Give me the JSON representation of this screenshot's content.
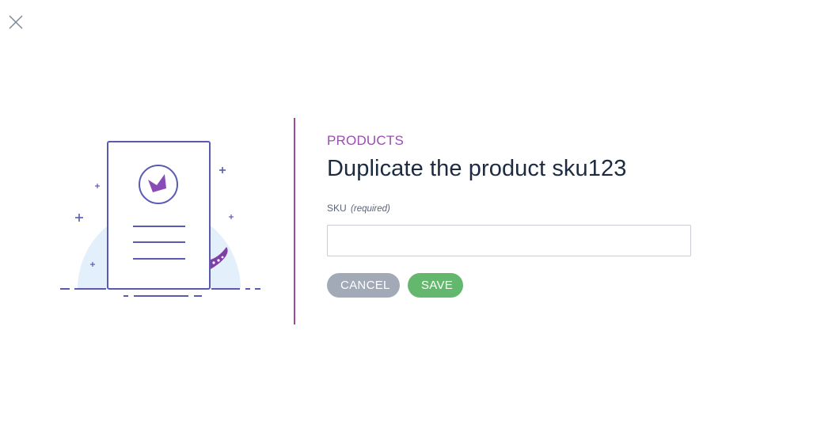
{
  "dialog": {
    "eyebrow": "PRODUCTS",
    "title": "Duplicate the product sku123"
  },
  "form": {
    "sku_label": "SKU",
    "sku_hint": "(required)",
    "sku_value": "",
    "sku_placeholder": ""
  },
  "actions": {
    "cancel_label": "CANCEL",
    "save_label": "SAVE"
  },
  "icons": {
    "close": "close-icon",
    "illustration": "document-illustration"
  },
  "colors": {
    "accent": "#9b4db0",
    "title": "#1d2b42",
    "cancel": "#a3aab7",
    "save": "#64b86d"
  }
}
